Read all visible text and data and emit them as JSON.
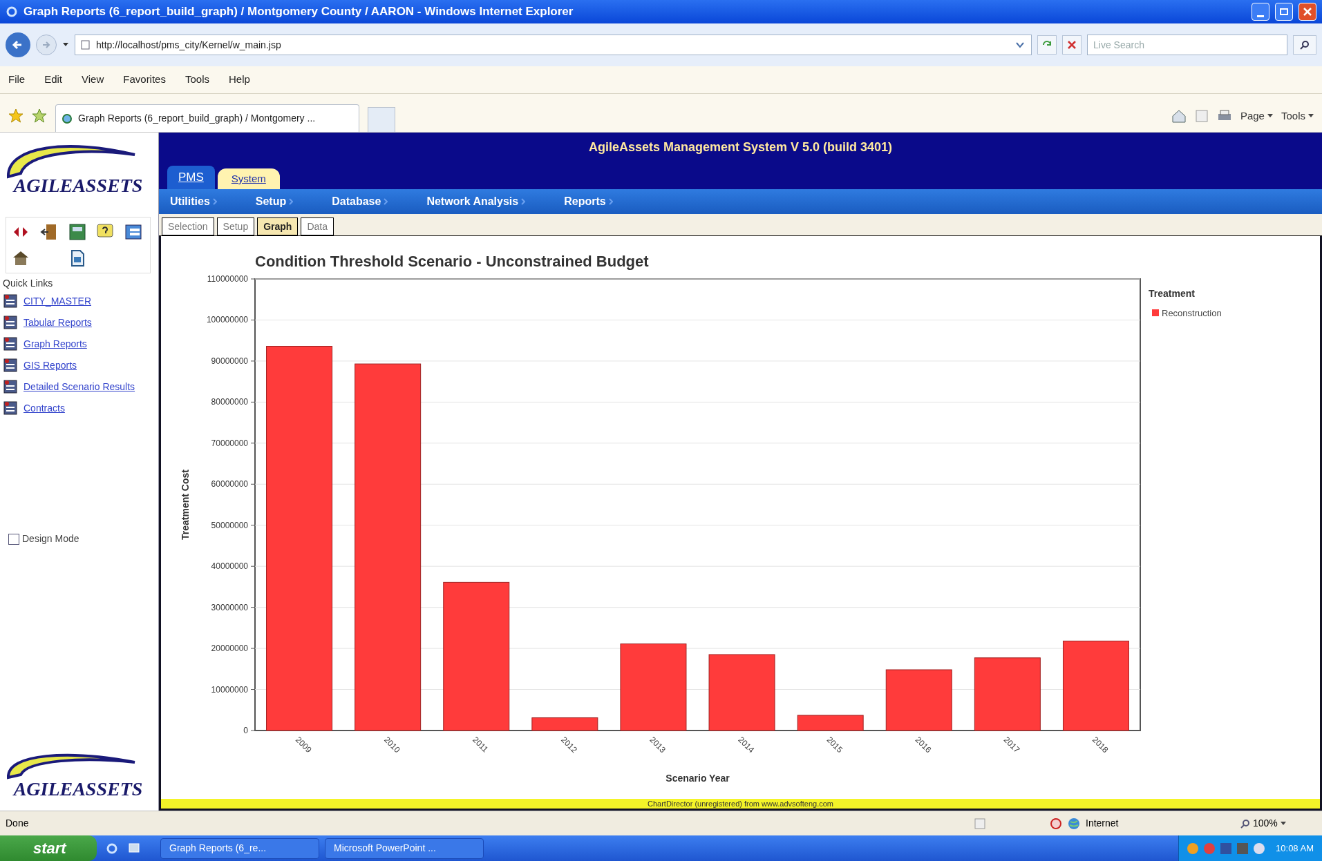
{
  "window": {
    "title": "Graph Reports (6_report_build_graph) / Montgomery County / AARON - Windows Internet Explorer"
  },
  "address_bar": {
    "url": "http://localhost/pms_city/Kernel/w_main.jsp"
  },
  "search": {
    "placeholder": "Live Search"
  },
  "menu": [
    "File",
    "Edit",
    "View",
    "Favorites",
    "Tools",
    "Help"
  ],
  "browser_tab": {
    "title": "Graph Reports (6_report_build_graph) / Montgomery ..."
  },
  "command_bar": [
    "Page",
    "Tools"
  ],
  "sidebar": {
    "logo": "AGILEASSETS",
    "quick_links_title": "Quick Links",
    "quick_links": [
      "CITY_MASTER",
      "Tabular Reports",
      "Graph Reports",
      "GIS Reports",
      "Detailed Scenario Results",
      "Contracts"
    ],
    "design_mode": {
      "label": "Design Mode",
      "checked": false
    },
    "footer_logo": "AGILEASSETS"
  },
  "header": {
    "title": "AgileAssets Management System V 5.0 (build 3401)"
  },
  "module_tabs": [
    {
      "label": "PMS",
      "selected": true
    },
    {
      "label": "System",
      "selected": false
    }
  ],
  "nav": [
    "Utilities",
    "Setup",
    "Database",
    "Network Analysis",
    "Reports"
  ],
  "sub_tabs": [
    {
      "label": "Selection",
      "selected": false
    },
    {
      "label": "Setup",
      "selected": false
    },
    {
      "label": "Graph",
      "selected": true
    },
    {
      "label": "Data",
      "selected": false
    }
  ],
  "chart": {
    "legend_title": "Treatment",
    "credit": "ChartDirector (unregistered) from www.advsofteng.com",
    "chart_data": {
      "type": "bar",
      "title": "Condition Threshold Scenario - Unconstrained Budget",
      "xlabel": "Scenario Year",
      "ylabel": "Treatment Cost",
      "categories": [
        "2009",
        "2010",
        "2011",
        "2012",
        "2013",
        "2014",
        "2015",
        "2016",
        "2017",
        "2018"
      ],
      "series": [
        {
          "name": "Reconstruction",
          "color": "#ff3b3b",
          "values": [
            93600000,
            89300000,
            36100000,
            3100000,
            21100000,
            18500000,
            3700000,
            14800000,
            17700000,
            21800000
          ]
        }
      ],
      "grid": true,
      "ylim": [
        0,
        110000000
      ],
      "yticks": [
        0,
        10000000,
        20000000,
        30000000,
        40000000,
        50000000,
        60000000,
        70000000,
        80000000,
        90000000,
        100000000,
        110000000
      ]
    }
  },
  "status_bar": {
    "text": "Done",
    "zone": "Internet",
    "zoom": "100%"
  },
  "taskbar": {
    "start": "start",
    "items": [
      "Graph Reports (6_re...",
      "Microsoft PowerPoint ..."
    ],
    "clock": "10:08 AM"
  }
}
